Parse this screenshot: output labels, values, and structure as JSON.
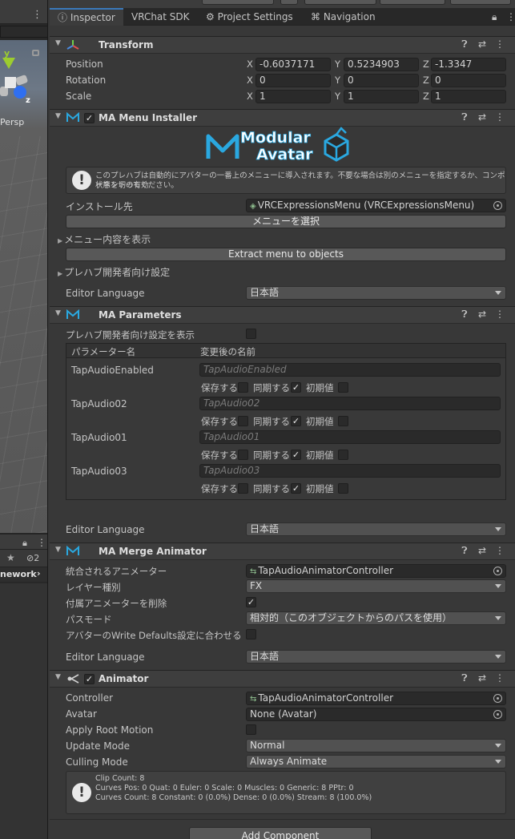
{
  "tabs": {
    "inspector": "Inspector",
    "vrchat_sdk": "VRChat SDK",
    "project_settings": "Project Settings",
    "navigation": "Navigation"
  },
  "scene": {
    "persp": "Persp",
    "axis_y": "y",
    "axis_z": "z",
    "framework": "nework",
    "hidden_count": "2"
  },
  "transform": {
    "title": "Transform",
    "rows": [
      {
        "label": "Position",
        "x": "-0.6037171",
        "y": "0.5234903",
        "z": "-1.3347"
      },
      {
        "label": "Rotation",
        "x": "0",
        "y": "0",
        "z": "0"
      },
      {
        "label": "Scale",
        "x": "1",
        "y": "1",
        "z": "1"
      }
    ],
    "axis_x": "X",
    "axis_y": "Y",
    "axis_z": "Z"
  },
  "menu_installer": {
    "title": "MA Menu Installer",
    "logo_line1": "Modular",
    "logo_line2": "Avatar",
    "help_line1": "このプレハブは自動的にアバターの一番上のメニューに導入されます。不要な場合は別のメニューを指定するか、コンポーネントの有効",
    "help_line2": "状態を切ってください。",
    "install_label": "インストール先",
    "install_value": "VRCExpressionsMenu (VRCExpressionsMenu)",
    "select_menu_button": "メニューを選択",
    "show_menu_contents": "メニュー内容を表示",
    "extract_button": "Extract menu to objects",
    "prefab_dev_settings": "プレハブ開発者向け設定",
    "editor_language_label": "Editor Language",
    "editor_language_value": "日本語"
  },
  "parameters": {
    "title": "MA Parameters",
    "show_dev_settings": "プレハブ開発者向け設定を表示",
    "col_name": "パラメーター名",
    "col_renamed": "変更後の名前",
    "save_label": "保存する",
    "sync_label": "同期する",
    "default_label": "初期値",
    "items": [
      {
        "name": "TapAudioEnabled",
        "placeholder": "TapAudioEnabled"
      },
      {
        "name": "TapAudio02",
        "placeholder": "TapAudio02"
      },
      {
        "name": "TapAudio01",
        "placeholder": "TapAudio01"
      },
      {
        "name": "TapAudio03",
        "placeholder": "TapAudio03"
      }
    ],
    "editor_language_label": "Editor Language",
    "editor_language_value": "日本語"
  },
  "merge_animator": {
    "title": "MA Merge Animator",
    "animator_label": "統合されるアニメーター",
    "animator_value": "TapAudioAnimatorController",
    "layer_label": "レイヤー種別",
    "layer_value": "FX",
    "delete_label": "付属アニメーターを削除",
    "path_mode_label": "パスモード",
    "path_mode_value": "相対的（このオブジェクトからのパスを使用）",
    "match_wd_label": "アバターのWrite Defaults設定に合わせる",
    "editor_language_label": "Editor Language",
    "editor_language_value": "日本語"
  },
  "animator": {
    "title": "Animator",
    "controller_label": "Controller",
    "controller_value": "TapAudioAnimatorController",
    "avatar_label": "Avatar",
    "avatar_value": "None (Avatar)",
    "root_motion_label": "Apply Root Motion",
    "update_mode_label": "Update Mode",
    "update_mode_value": "Normal",
    "culling_mode_label": "Culling Mode",
    "culling_mode_value": "Always Animate",
    "info_line1": "Clip Count: 8",
    "info_line2": "Curves Pos: 0 Quat: 0 Euler: 0 Scale: 0 Muscles: 0 Generic: 8 PPtr: 0",
    "info_line3": "Curves Count: 8 Constant: 0 (0.0%) Dense: 0 (0.0%) Stream: 8 (100.0%)"
  },
  "add_component": "Add Component",
  "colors": {
    "accent": "#3a79bb",
    "logo_blue": "#2aa8e0",
    "bg": "#383838"
  }
}
